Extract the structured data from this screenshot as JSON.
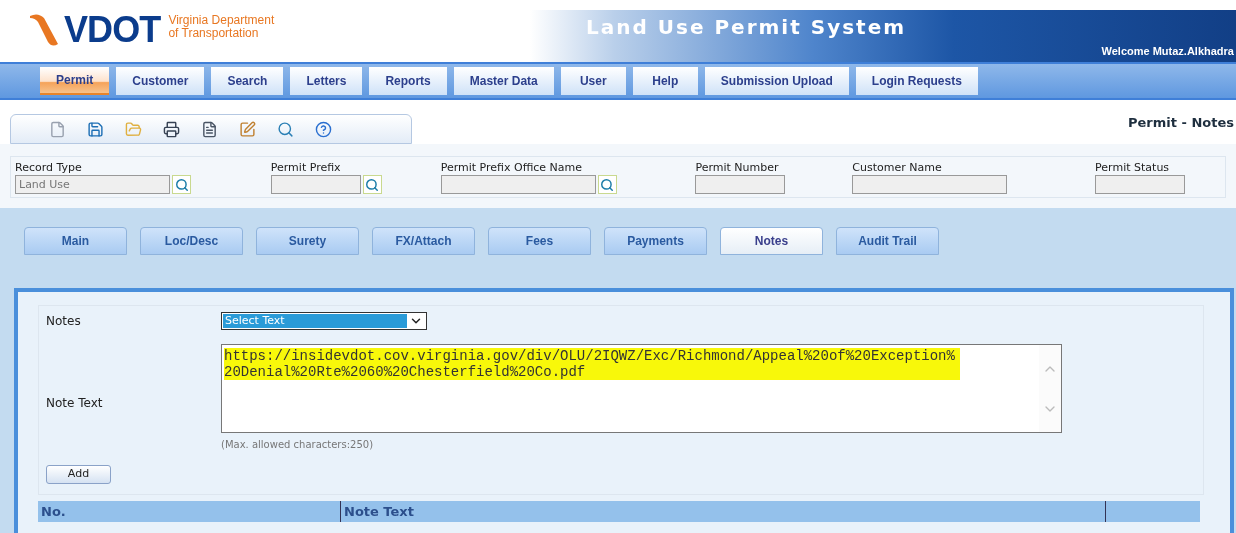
{
  "header": {
    "logo_text": "VDOT",
    "logo_subtitle": [
      "Virginia Department",
      "of Transportation"
    ],
    "title": "Land Use Permit System",
    "welcome": "Welcome Mutaz.Alkhadra"
  },
  "nav": [
    {
      "label": "Permit",
      "selected": true
    },
    {
      "label": "Customer",
      "selected": false
    },
    {
      "label": "Search",
      "selected": false
    },
    {
      "label": "Letters",
      "selected": false
    },
    {
      "label": "Reports",
      "selected": false
    },
    {
      "label": "Master Data",
      "selected": false
    },
    {
      "label": "User",
      "selected": false
    },
    {
      "label": "Help",
      "selected": false
    },
    {
      "label": "Submission Upload",
      "selected": false
    },
    {
      "label": "Login Requests",
      "selected": false
    }
  ],
  "page_title": "Permit - Notes",
  "fields": [
    {
      "label": "Record Type",
      "value": "Land Use",
      "lookup": true
    },
    {
      "label": "Permit Prefix",
      "lookup": true
    },
    {
      "label": "Permit Prefix Office Name",
      "lookup": true
    },
    {
      "label": "Permit Number",
      "lookup": false
    },
    {
      "label": "Customer Name",
      "lookup": false
    },
    {
      "label": "Permit Status",
      "lookup": false
    }
  ],
  "tabs": [
    {
      "label": "Main",
      "selected": false
    },
    {
      "label": "Loc/Desc",
      "selected": false
    },
    {
      "label": "Surety",
      "selected": false
    },
    {
      "label": "FX/Attach",
      "selected": false
    },
    {
      "label": "Fees",
      "selected": false
    },
    {
      "label": "Payments",
      "selected": false
    },
    {
      "label": "Notes",
      "selected": true
    },
    {
      "label": "Audit Trail",
      "selected": false
    }
  ],
  "notes_form": {
    "notes_label": "Notes",
    "notes_select": "Select Text",
    "note_text_label": "Note Text",
    "note_text": "https://insidevdot.cov.virginia.gov/div/OLU/2IQWZ/Exc/Richmond/Appeal%20of%20Exception%20Denial%20Rte%2060%20Chesterfield%20Co.pdf",
    "hint": "(Max. allowed characters:250)",
    "add_button": "Add"
  },
  "table": {
    "columns": [
      "No.",
      "Note Text"
    ]
  }
}
